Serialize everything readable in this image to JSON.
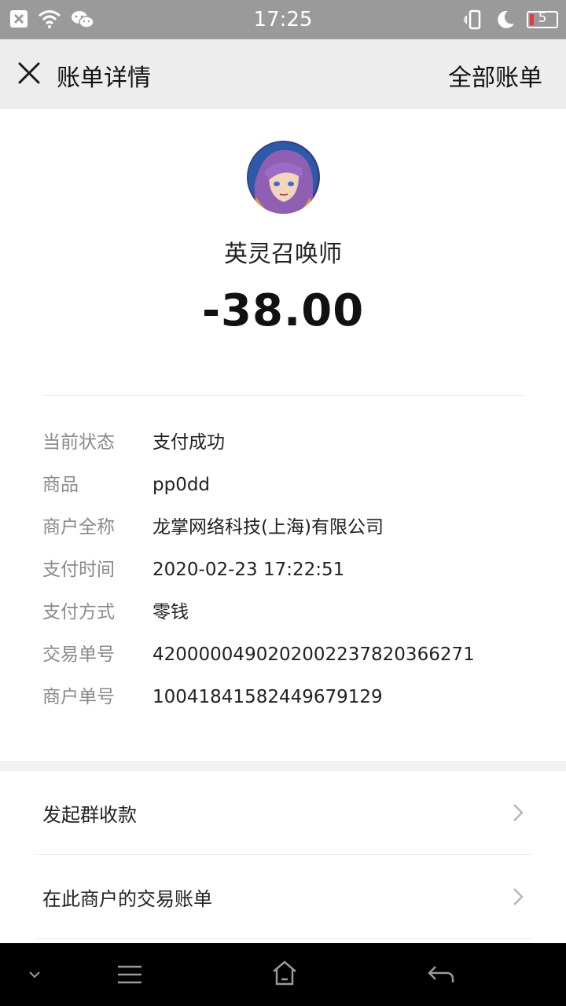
{
  "status_bar": {
    "time": "17:25",
    "battery_level": "5",
    "icons": [
      "notification-close-icon",
      "wifi-icon",
      "wechat-icon",
      "vibrate-icon",
      "moon-icon",
      "battery-icon"
    ]
  },
  "header": {
    "title": "账单详情",
    "right_link": "全部账单",
    "close_icon": "close-icon"
  },
  "summary": {
    "merchant_name": "英灵召唤师",
    "amount": "-38.00"
  },
  "details": [
    {
      "label": "当前状态",
      "value": "支付成功"
    },
    {
      "label": "商品",
      "value": "pp0dd"
    },
    {
      "label": "商户全称",
      "value": "龙掌网络科技(上海)有限公司"
    },
    {
      "label": "支付时间",
      "value": "2020-02-23 17:22:51"
    },
    {
      "label": "支付方式",
      "value": "零钱"
    },
    {
      "label": "交易单号",
      "value": "4200000490202002237820366271"
    },
    {
      "label": "商户单号",
      "value": "10041841582449679129"
    }
  ],
  "actions": [
    {
      "label": "发起群收款",
      "icon": "chevron-right-icon"
    },
    {
      "label": "在此商户的交易账单",
      "icon": "chevron-right-icon"
    }
  ],
  "nav_bar": {
    "icons": [
      "chevron-down-icon",
      "menu-icon",
      "home-icon",
      "back-icon"
    ]
  },
  "colors": {
    "status_bar": "#9a9a9a",
    "header_bg": "#ededed",
    "label": "#8a8a8a",
    "battery_low": "#e53935"
  }
}
